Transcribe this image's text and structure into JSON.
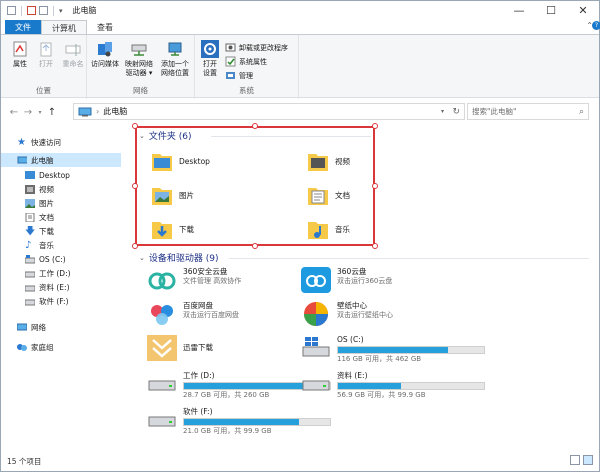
{
  "window": {
    "title": "此电脑"
  },
  "tabs": {
    "file": "文件",
    "computer": "计算机",
    "view": "查看"
  },
  "ribbon": {
    "props": "属性",
    "open": "打开",
    "rename": "重命名",
    "access_media": "访问媒体",
    "map_drive_1": "映射网络",
    "map_drive_2": "驱动器 ▾",
    "add_location_1": "添加一个",
    "add_location_2": "网络位置",
    "open_settings_1": "打开",
    "open_settings_2": "设置",
    "uninstall": "卸载或更改程序",
    "sys_props": "系统属性",
    "manage": "管理",
    "group_location": "位置",
    "group_network": "网络",
    "group_system": "系统"
  },
  "address": {
    "path": "此电脑",
    "search_placeholder": "搜索\"此电脑\""
  },
  "nav": {
    "quick_access": "快速访问",
    "this_pc": "此电脑",
    "items": [
      "Desktop",
      "视频",
      "图片",
      "文档",
      "下载",
      "音乐",
      "OS (C:)",
      "工作 (D:)",
      "资料 (E:)",
      "软件 (F:)"
    ],
    "network": "网络",
    "homegroup": "家庭组"
  },
  "folders": {
    "header": "文件夹 (6)",
    "items": [
      "Desktop",
      "视频",
      "图片",
      "文档",
      "下载",
      "音乐"
    ]
  },
  "devices": {
    "header": "设备和驱动器 (9)",
    "apps": [
      {
        "name": "360安全云盘",
        "sub": "文件管理 高效协作"
      },
      {
        "name": "360云盘",
        "sub": "双击运行360云盘"
      },
      {
        "name": "百度网盘",
        "sub": "双击运行百度网盘"
      },
      {
        "name": "壁纸中心",
        "sub": "双击运行壁纸中心"
      },
      {
        "name": "迅雷下载",
        "sub": ""
      }
    ],
    "drives": [
      {
        "name": "OS (C:)",
        "sub": "116 GB 可用，共 462 GB",
        "used": 0.75
      },
      {
        "name": "工作 (D:)",
        "sub": "28.7 GB 可用，共 260 GB",
        "used": 0.89
      },
      {
        "name": "资料 (E:)",
        "sub": "56.9 GB 可用，共 99.9 GB",
        "used": 0.43
      },
      {
        "name": "软件 (F:)",
        "sub": "21.0 GB 可用，共 99.9 GB",
        "used": 0.79
      }
    ]
  },
  "status": {
    "count": "15 个项目"
  },
  "colors": {
    "accent": "#1979ca",
    "bar": "#26a0da",
    "selection": "#d9373a"
  }
}
